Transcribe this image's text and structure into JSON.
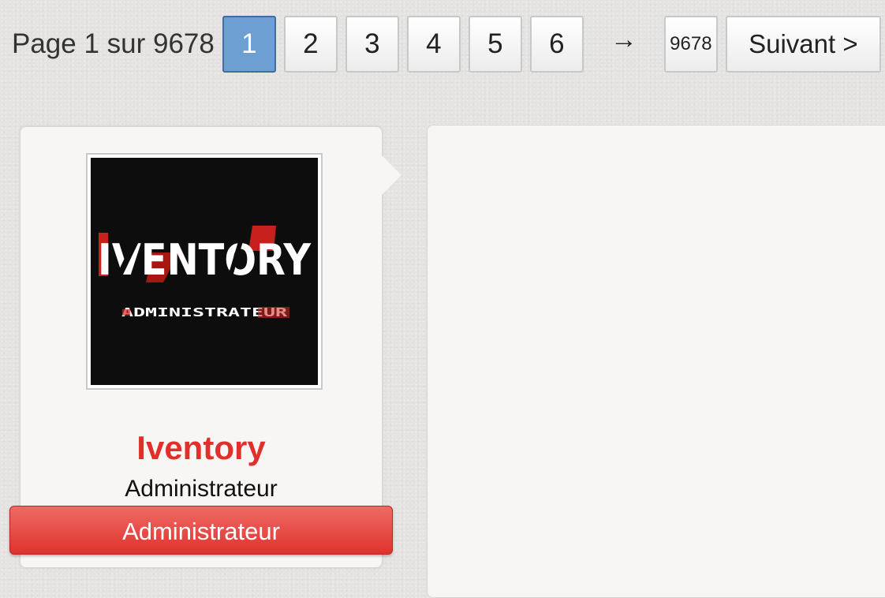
{
  "pagination": {
    "info": "Page 1 sur 9678",
    "pages": [
      "1",
      "2",
      "3",
      "4",
      "5",
      "6"
    ],
    "current_page": "1",
    "arrow": "→",
    "last_page": "9678",
    "next_label": "Suivant >"
  },
  "profile": {
    "avatar_text": "IVENTORY",
    "avatar_subtext": "ADMINISTRATEUR",
    "username": "Iventory",
    "rank_text": "Administrateur",
    "rank_ribbon": "Administrateur"
  },
  "colors": {
    "username": "#e1302b",
    "ribbon": "#e0322d",
    "active_page": "#6e9fd2",
    "background": "#e4e3e1"
  }
}
